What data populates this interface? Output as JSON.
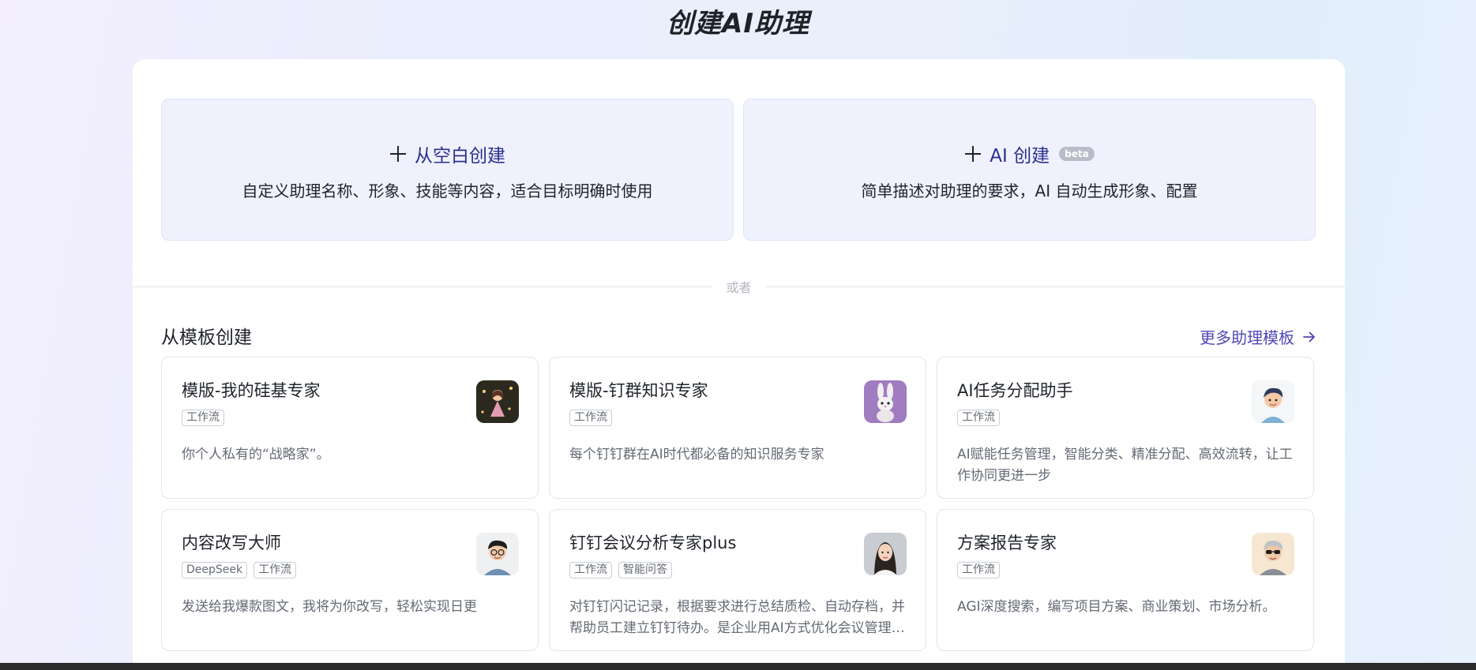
{
  "page": {
    "title": "创建AI助理"
  },
  "create_options": {
    "blank": {
      "label": "从空白创建",
      "description": "自定义助理名称、形象、技能等内容，适合目标明确时使用"
    },
    "ai": {
      "label": "AI 创建",
      "badge": "beta",
      "description": "简单描述对助理的要求，AI 自动生成形象、配置"
    }
  },
  "divider": {
    "text": "或者"
  },
  "templates": {
    "section_title": "从模板创建",
    "more_link": "更多助理模板",
    "items": [
      {
        "name": "模版-我的硅基专家",
        "tags": [
          "工作流"
        ],
        "description": "你个人私有的“战略家”。",
        "avatar": "girl-in-forest-avatar"
      },
      {
        "name": "模版-钉群知识专家",
        "tags": [
          "工作流"
        ],
        "description": "每个钉钉群在AI时代都必备的知识服务专家",
        "avatar": "rabbit-avatar"
      },
      {
        "name": "AI任务分配助手",
        "tags": [
          "工作流"
        ],
        "description": "AI赋能任务管理，智能分类、精准分配、高效流转，让工作协同更进一步",
        "avatar": "young-man-cartoon-avatar"
      },
      {
        "name": "内容改写大师",
        "tags": [
          "DeepSeek",
          "工作流"
        ],
        "description": "发送给我爆款图文，我将为你改写，轻松实现日更",
        "avatar": "man-with-glasses-avatar"
      },
      {
        "name": "钉钉会议分析专家plus",
        "tags": [
          "工作流",
          "智能问答"
        ],
        "description": "对钉钉闪记记录，根据要求进行总结质检、自动存档，并帮助员工建立钉钉待办。是企业用AI方式优化会议管理的最佳实践",
        "avatar": "woman-portrait-avatar"
      },
      {
        "name": "方案报告专家",
        "tags": [
          "工作流"
        ],
        "description": "AGI深度搜索，编写项目方案、商业策划、市场分析。",
        "avatar": "elder-with-sunglasses-avatar"
      }
    ]
  },
  "colors": {
    "accent": "#4e48b8",
    "card_bg": "#eff2fd",
    "heading_accent": "#2b2f8c"
  }
}
